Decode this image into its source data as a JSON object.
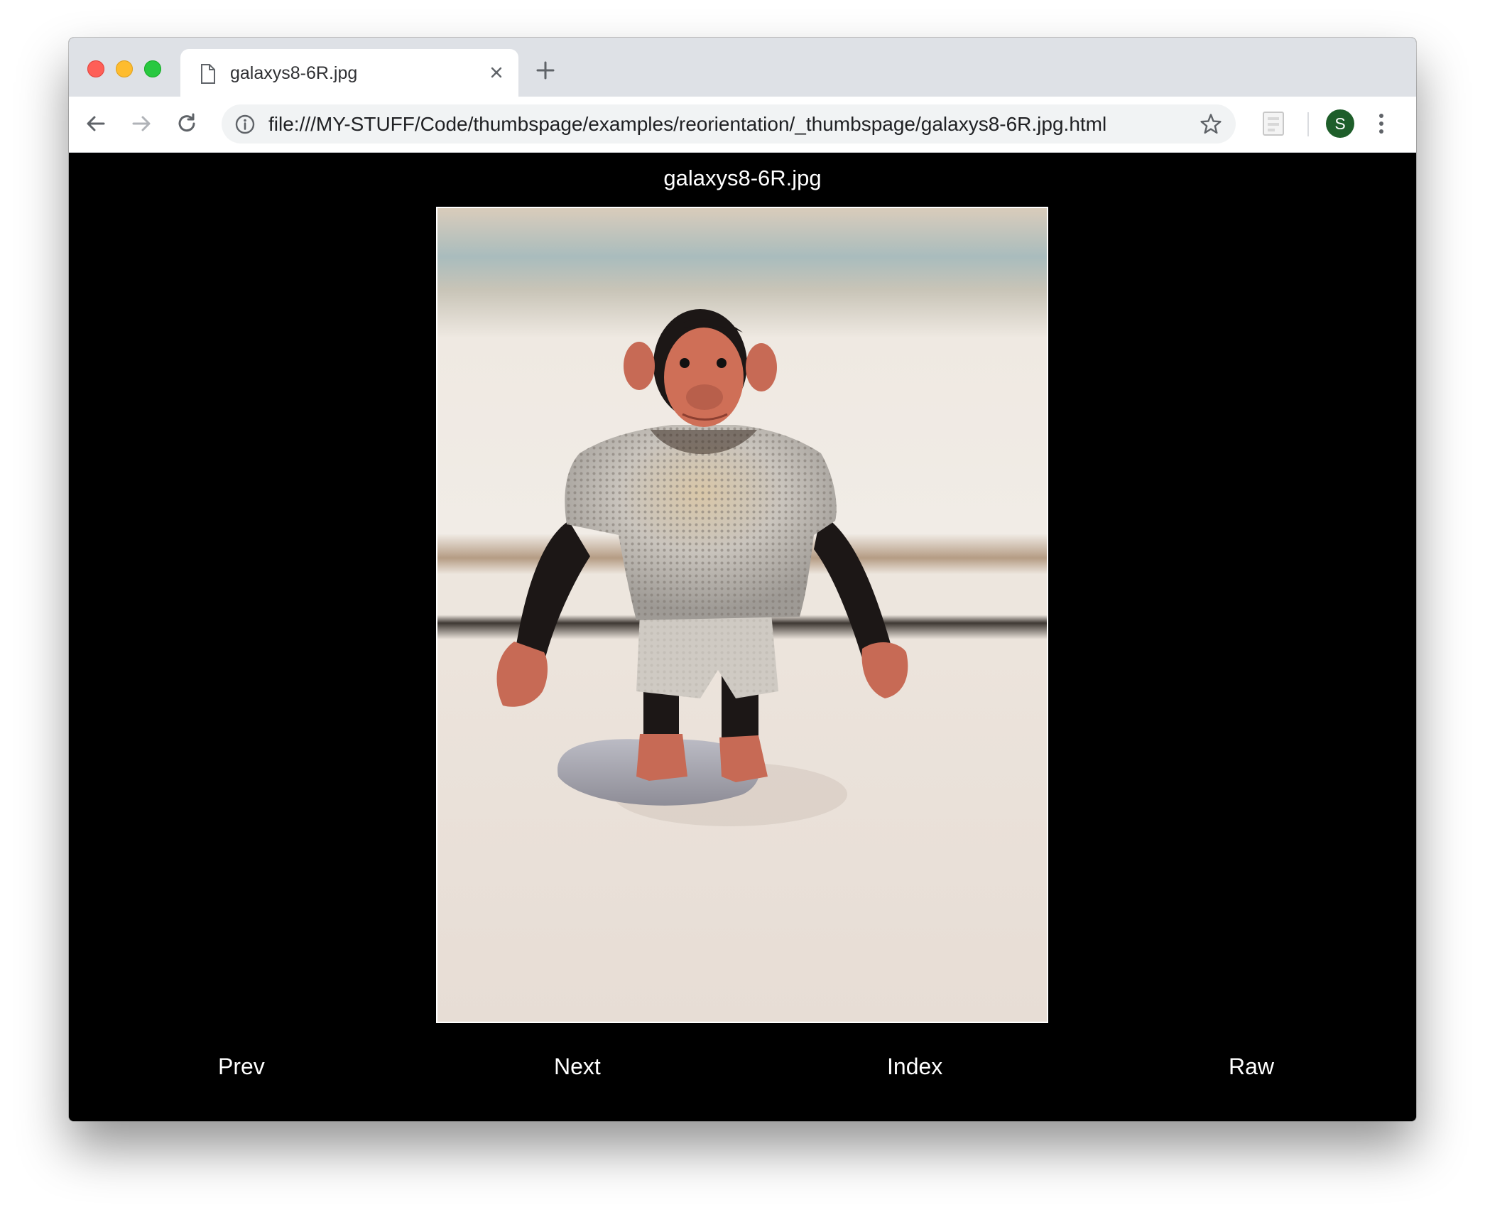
{
  "browser": {
    "tab": {
      "title": "galaxys8-6R.jpg",
      "icon": "document-icon"
    },
    "address": {
      "url": "file:///MY-STUFF/Code/thumbspage/examples/reorientation/_thumbspage/galaxys8-6R.jpg.html"
    },
    "profile": {
      "initial": "S",
      "color": "#1e5e2a"
    }
  },
  "page": {
    "title": "galaxys8-6R.jpg",
    "image": {
      "alt": "galaxys8-6R.jpg"
    },
    "nav": {
      "prev": "Prev",
      "next": "Next",
      "index": "Index",
      "raw": "Raw"
    },
    "colors": {
      "background": "#000000",
      "text": "#ffffff"
    }
  }
}
